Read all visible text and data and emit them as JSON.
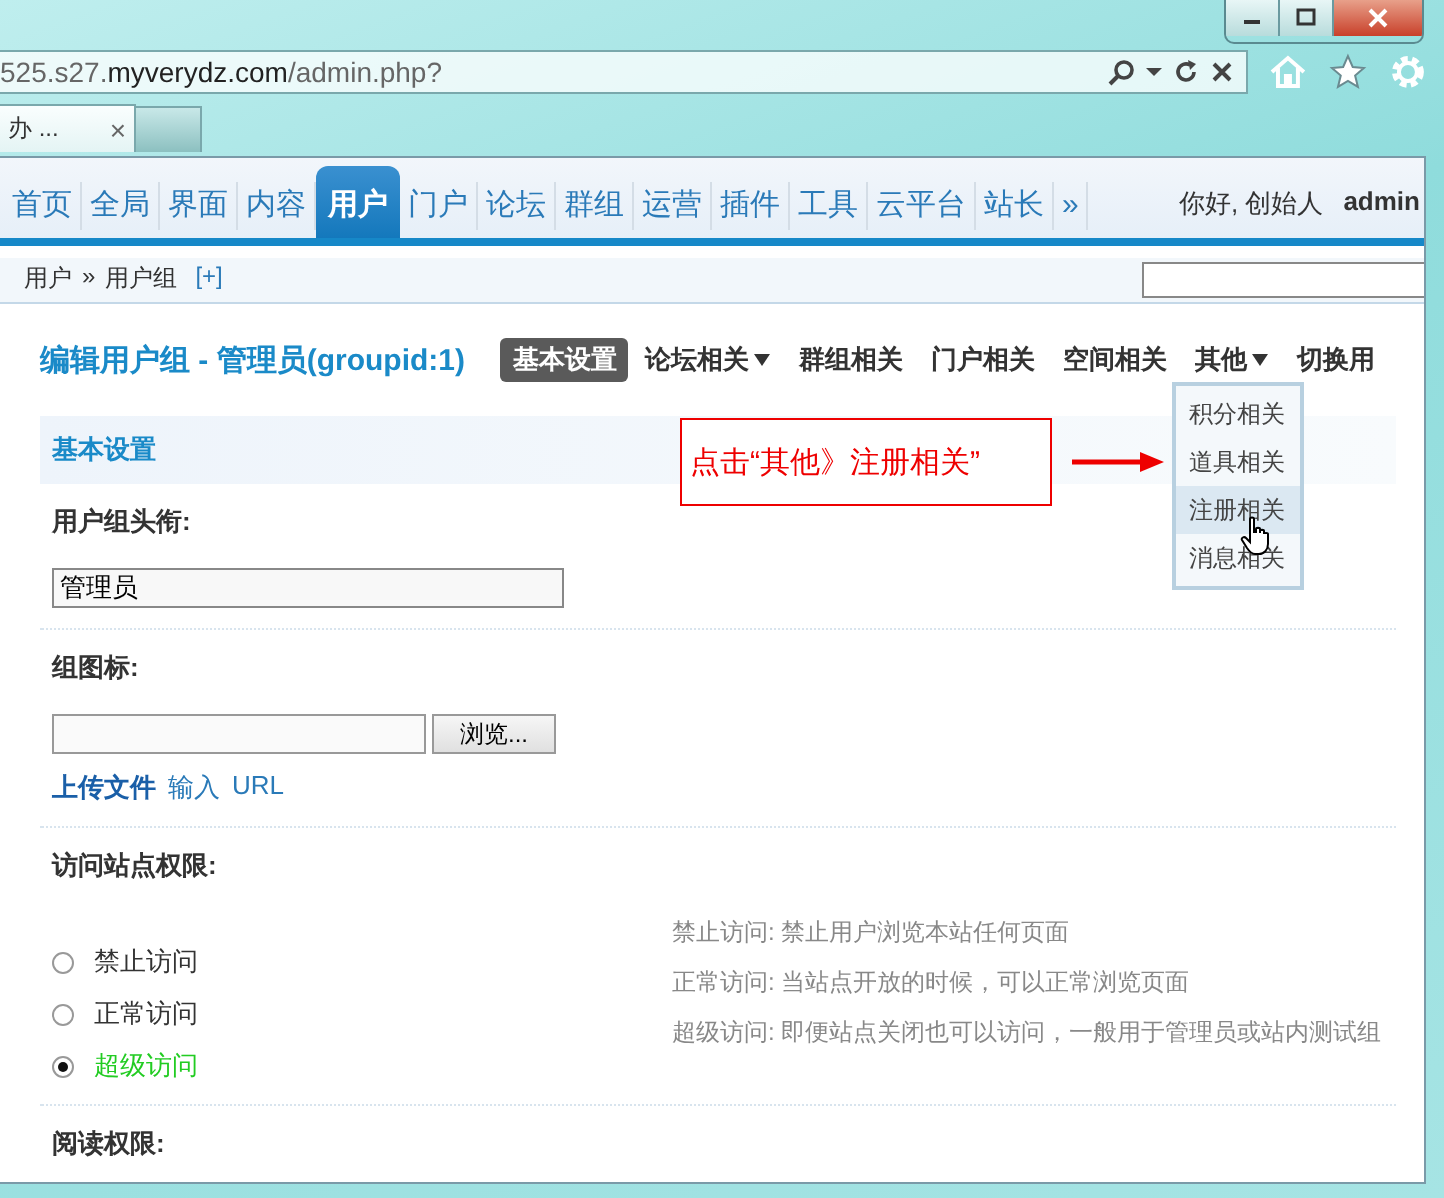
{
  "browser": {
    "address_dim": "525.s27.",
    "address_host": "myverydz.com",
    "address_path": "/admin.php?",
    "tab": {
      "title": "办 ...",
      "close": "×"
    }
  },
  "nav": {
    "items": [
      {
        "label": "首页",
        "selected": false
      },
      {
        "label": "全局",
        "selected": false
      },
      {
        "label": "界面",
        "selected": false
      },
      {
        "label": "内容",
        "selected": false
      },
      {
        "label": "用户",
        "selected": true
      },
      {
        "label": "门户",
        "selected": false
      },
      {
        "label": "论坛",
        "selected": false
      },
      {
        "label": "群组",
        "selected": false
      },
      {
        "label": "运营",
        "selected": false
      },
      {
        "label": "插件",
        "selected": false
      },
      {
        "label": "工具",
        "selected": false
      },
      {
        "label": "云平台",
        "selected": false
      },
      {
        "label": "站长",
        "selected": false
      },
      {
        "label": "»",
        "selected": false
      }
    ],
    "greeting": "你好, 创始人",
    "user": "admin"
  },
  "breadcrumb": {
    "items": [
      "用户",
      "用户组"
    ],
    "separator": "»",
    "add": "[+]"
  },
  "title": "编辑用户组 - 管理员(groupid:1)",
  "subtabs": [
    {
      "label": "基本设置",
      "selected": true,
      "dropdown": false
    },
    {
      "label": "论坛相关",
      "selected": false,
      "dropdown": true
    },
    {
      "label": "群组相关",
      "selected": false,
      "dropdown": false
    },
    {
      "label": "门户相关",
      "selected": false,
      "dropdown": false
    },
    {
      "label": "空间相关",
      "selected": false,
      "dropdown": false
    },
    {
      "label": "其他",
      "selected": false,
      "dropdown": true,
      "menu": [
        {
          "label": "积分相关",
          "selected": false
        },
        {
          "label": "道具相关",
          "selected": false
        },
        {
          "label": "注册相关",
          "selected": true
        },
        {
          "label": "消息相关",
          "selected": false
        }
      ]
    },
    {
      "label": "切换用",
      "selected": false,
      "dropdown": false
    }
  ],
  "callout": {
    "text": "点击“其他》注册相关”"
  },
  "section": "基本设置",
  "group_title": {
    "label": "用户组头衔:",
    "value": "管理员"
  },
  "group_icon": {
    "label": "组图标:",
    "browse": "浏览...",
    "upload": "上传文件",
    "input": "输入",
    "url": "URL"
  },
  "access": {
    "label": "访问站点权限:",
    "options": [
      {
        "label": "禁止访问",
        "selected": false
      },
      {
        "label": "正常访问",
        "selected": false
      },
      {
        "label": "超级访问",
        "selected": true
      }
    ],
    "descriptions": [
      "禁止访问: 禁止用户浏览本站任何页面",
      "正常访问: 当站点开放的时候，可以正常浏览页面",
      "超级访问: 即便站点关闭也可以访问，一般用于管理员或站内测试组"
    ]
  },
  "read": {
    "label": "阅读权限:"
  }
}
